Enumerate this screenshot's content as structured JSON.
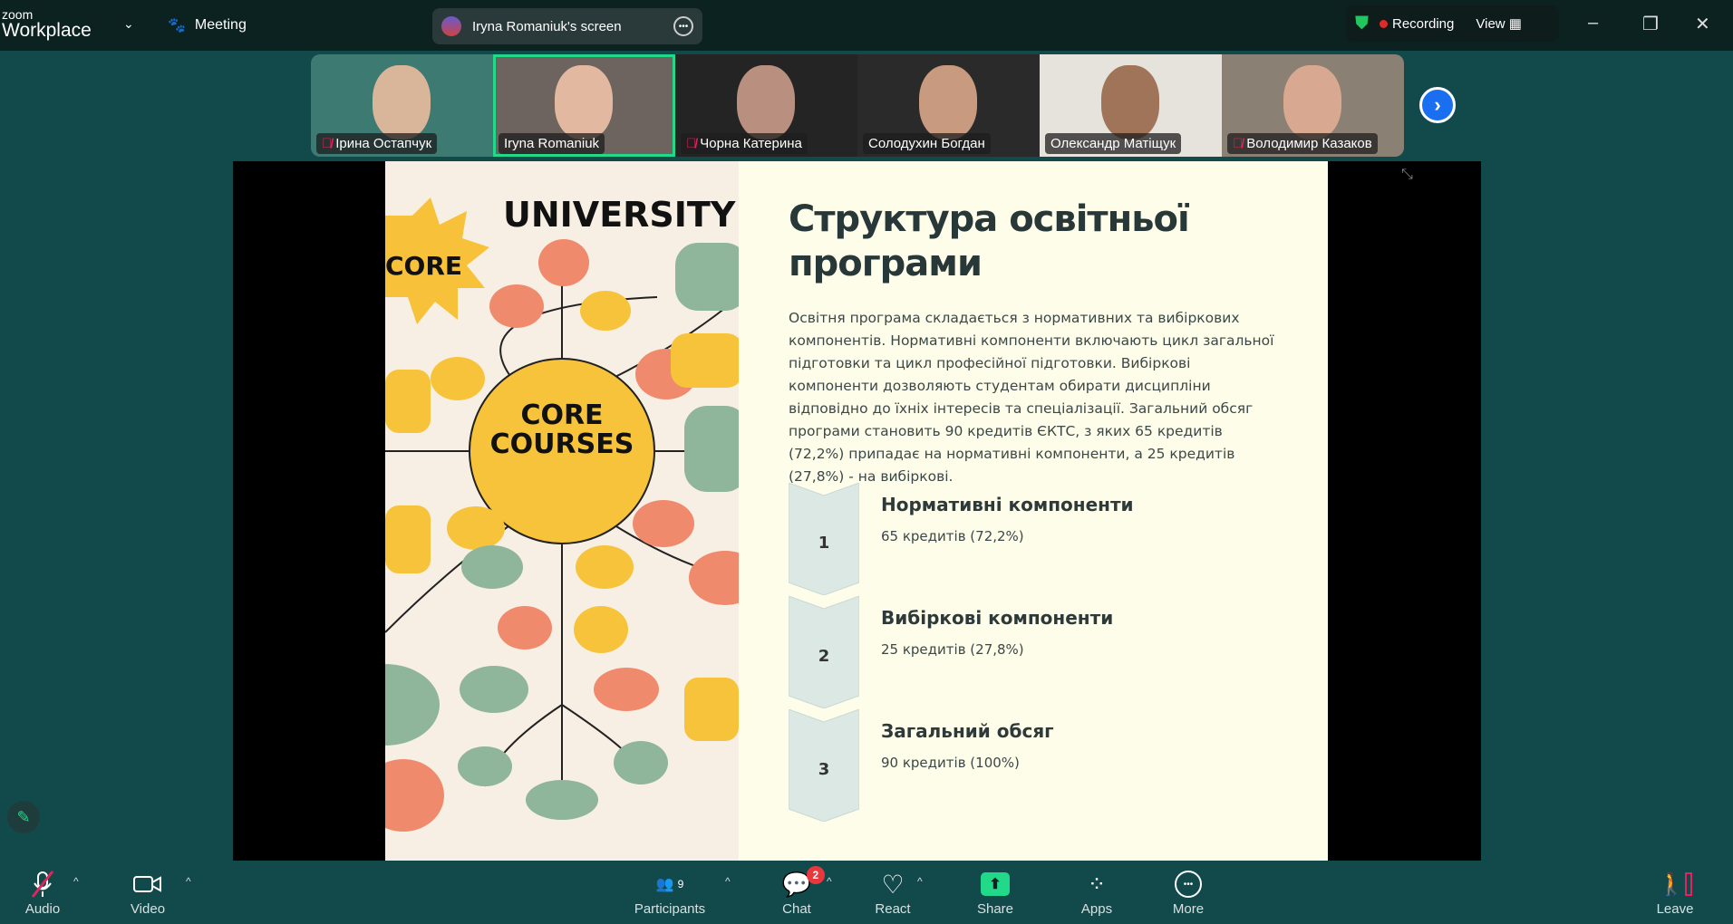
{
  "app": {
    "logo_small": "zoom",
    "logo_big": "Workplace",
    "meeting_label": "Meeting",
    "screen_label": "Iryna Romaniuk's screen",
    "recording_label": "Recording",
    "view_label": "View"
  },
  "participants": [
    {
      "name": "Ірина Остапчук",
      "muted": true,
      "bg": "#3d7a72",
      "face": "#d9b59a"
    },
    {
      "name": "Iryna Romaniuk",
      "muted": false,
      "active": true,
      "bg": "#6d6460",
      "face": "#e2b8a0"
    },
    {
      "name": "Чорна Катерина",
      "muted": true,
      "bg": "#242424",
      "face": "#b99080"
    },
    {
      "name": "Солодухин Богдан",
      "muted": false,
      "bg": "#2a2a2a",
      "face": "#c89a80"
    },
    {
      "name": "Олександр Матіщук",
      "muted": false,
      "bg": "#e6e2dc",
      "face": "#a07458"
    },
    {
      "name": "Володимир Казаков",
      "muted": true,
      "bg": "#8a8074",
      "face": "#d8a890"
    }
  ],
  "slide": {
    "title": "Структура освітньої програми",
    "paragraph": "Освітня програма складається з нормативних та вибіркових компонентів. Нормативні компоненти включають цикл загальної підготовки та цикл професійної підготовки. Вибіркові компоненти дозволяють студентам обирати дисципліни відповідно до їхніх інтересів та спеціалізації. Загальний обсяг програми становить 90 кредитів ЄКТС, з яких 65 кредитів (72,2%) припадає на нормативні компоненти, а 25 кредитів (27,8%) - на вибіркові.",
    "items": [
      {
        "num": "1",
        "title": "Нормативні компоненти",
        "sub": "65 кредитів (72,2%)"
      },
      {
        "num": "2",
        "title": "Вибіркові компоненти",
        "sub": "25 кредитів (27,8%)"
      },
      {
        "num": "3",
        "title": "Загальний обсяг",
        "sub": "90 кредитів (100%)"
      }
    ],
    "image": {
      "heading": "UNIVERSITY",
      "center1": "CORE",
      "center2": "COURSES",
      "side": "CORE"
    }
  },
  "toolbar": {
    "audio": "Audio",
    "video": "Video",
    "participants": "Participants",
    "participants_count": "9",
    "chat": "Chat",
    "chat_badge": "2",
    "react": "React",
    "share": "Share",
    "apps": "Apps",
    "more": "More",
    "leave": "Leave"
  },
  "colors": {
    "background": "#124a4c",
    "topbar": "#0b2221",
    "share": "#22d889",
    "recording": "#e02a2a",
    "leave": "#e0245e"
  }
}
